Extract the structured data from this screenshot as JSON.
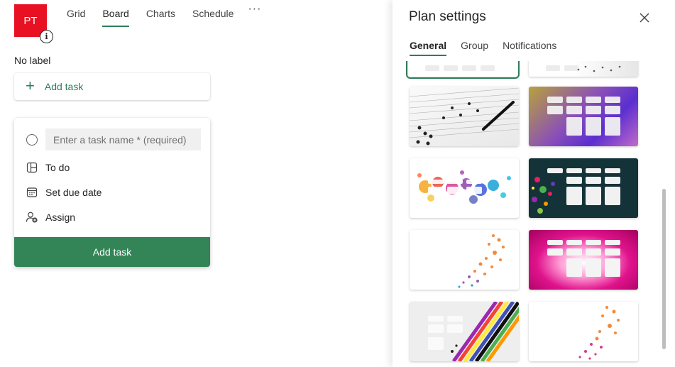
{
  "plan": {
    "avatar_initials": "PT",
    "info_icon": "info-icon"
  },
  "nav": {
    "items": [
      {
        "label": "Grid",
        "active": false
      },
      {
        "label": "Board",
        "active": true
      },
      {
        "label": "Charts",
        "active": false
      },
      {
        "label": "Schedule",
        "active": false
      }
    ],
    "more_label": "···"
  },
  "board": {
    "bucket_label": "No label",
    "add_task_label": "Add task",
    "new_task": {
      "placeholder": "Enter a task name * (required)",
      "bucket": "To do",
      "due_date": "Set due date",
      "assign": "Assign",
      "submit_label": "Add task"
    }
  },
  "panel": {
    "title": "Plan settings",
    "close_icon": "close-icon",
    "tabs": [
      {
        "label": "General",
        "active": true
      },
      {
        "label": "Group",
        "active": false
      },
      {
        "label": "Notifications",
        "active": false
      }
    ],
    "backgrounds": [
      {
        "name": "background-plain",
        "selected": true
      },
      {
        "name": "background-dots",
        "selected": false
      },
      {
        "name": "background-music-sheet",
        "selected": false
      },
      {
        "name": "background-purple-gold",
        "selected": false
      },
      {
        "name": "background-rainbow-splash",
        "selected": false
      },
      {
        "name": "background-dark-teal-confetti",
        "selected": false
      },
      {
        "name": "background-orange-dots",
        "selected": false
      },
      {
        "name": "background-magenta-glow",
        "selected": false
      },
      {
        "name": "background-rainbow-stripes",
        "selected": false
      },
      {
        "name": "background-pink-orange-dots",
        "selected": false
      }
    ]
  },
  "colors": {
    "accent": "#2e7d5b",
    "button": "#338457",
    "avatar": "#e81123"
  }
}
